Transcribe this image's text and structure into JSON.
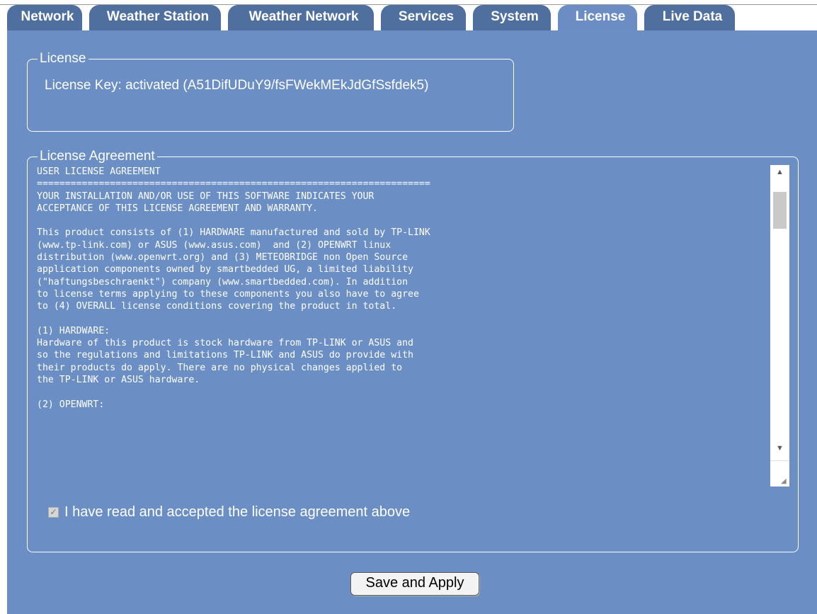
{
  "tabs": [
    {
      "label": "Network"
    },
    {
      "label": "Weather Station"
    },
    {
      "label": "Weather Network"
    },
    {
      "label": "Services"
    },
    {
      "label": "System"
    },
    {
      "label": "License"
    },
    {
      "label": "Live Data"
    }
  ],
  "active_tab": "License",
  "license": {
    "legend": "License",
    "key_text": "License Key: activated (A51DifUDuY9/fsFWekMEkJdGfSsfdek5)"
  },
  "agreement": {
    "legend": "License Agreement",
    "text": "USER LICENSE AGREEMENT\n======================================================================\nYOUR INSTALLATION AND/OR USE OF THIS SOFTWARE INDICATES YOUR\nACCEPTANCE OF THIS LICENSE AGREEMENT AND WARRANTY.\n\nThis product consists of (1) HARDWARE manufactured and sold by TP-LINK\n(www.tp-link.com) or ASUS (www.asus.com)  and (2) OPENWRT linux\ndistribution (www.openwrt.org) and (3) METEOBRIDGE non Open Source\napplication components owned by smartbedded UG, a limited liability\n(\"haftungsbeschraenkt\") company (www.smartbedded.com). In addition\nto license terms applying to these components you also have to agree\nto (4) OVERALL license conditions covering the product in total.\n\n(1) HARDWARE:\nHardware of this product is stock hardware from TP-LINK or ASUS and\nso the regulations and limitations TP-LINK and ASUS do provide with\ntheir products do apply. There are no physical changes applied to\nthe TP-LINK or ASUS hardware.\n\n(2) OPENWRT:",
    "checkbox_label": "I have read and accepted the license agreement above",
    "checked": true
  },
  "save_button": "Save and Apply",
  "icons": {
    "scroll_up": "triangle-up-icon",
    "scroll_down": "triangle-down-icon",
    "checkmark": "checkmark-icon",
    "resize": "resize-grip-icon"
  },
  "colors": {
    "panel_bg": "#6b8ec4",
    "tab_bg": "#4f6f9e",
    "text": "#ffffff"
  }
}
